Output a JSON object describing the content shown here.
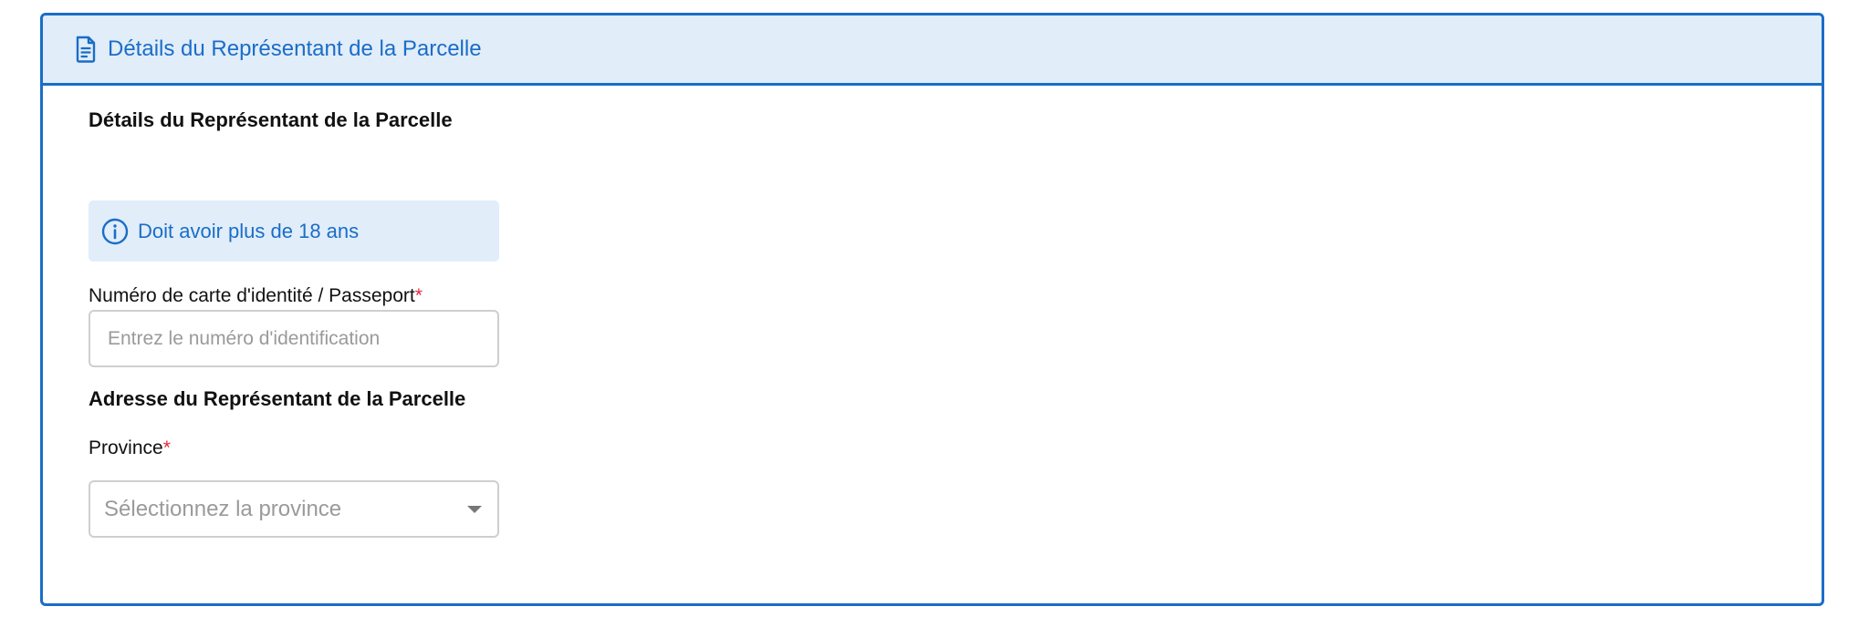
{
  "panel": {
    "title": "Détails du Représentant de la Parcelle",
    "title_icon": "document-icon"
  },
  "section_details": {
    "title": "Détails du Représentant de la Parcelle"
  },
  "info_notice": {
    "icon": "info-icon",
    "text": "Doit avoir plus de 18 ans"
  },
  "id_field": {
    "label": "Numéro de carte d'identité / Passeport",
    "required_marker": "*",
    "value": "",
    "placeholder": "Entrez le numéro d'identification"
  },
  "section_address": {
    "title": "Adresse du Représentant de la Parcelle"
  },
  "province_field": {
    "label": "Province",
    "required_marker": "*",
    "selected": "Sélectionnez la province",
    "icon": "chevron-down-icon"
  },
  "colors": {
    "accent": "#1a6dc8",
    "header_bg": "#e1edf9",
    "required": "#e0283b"
  }
}
